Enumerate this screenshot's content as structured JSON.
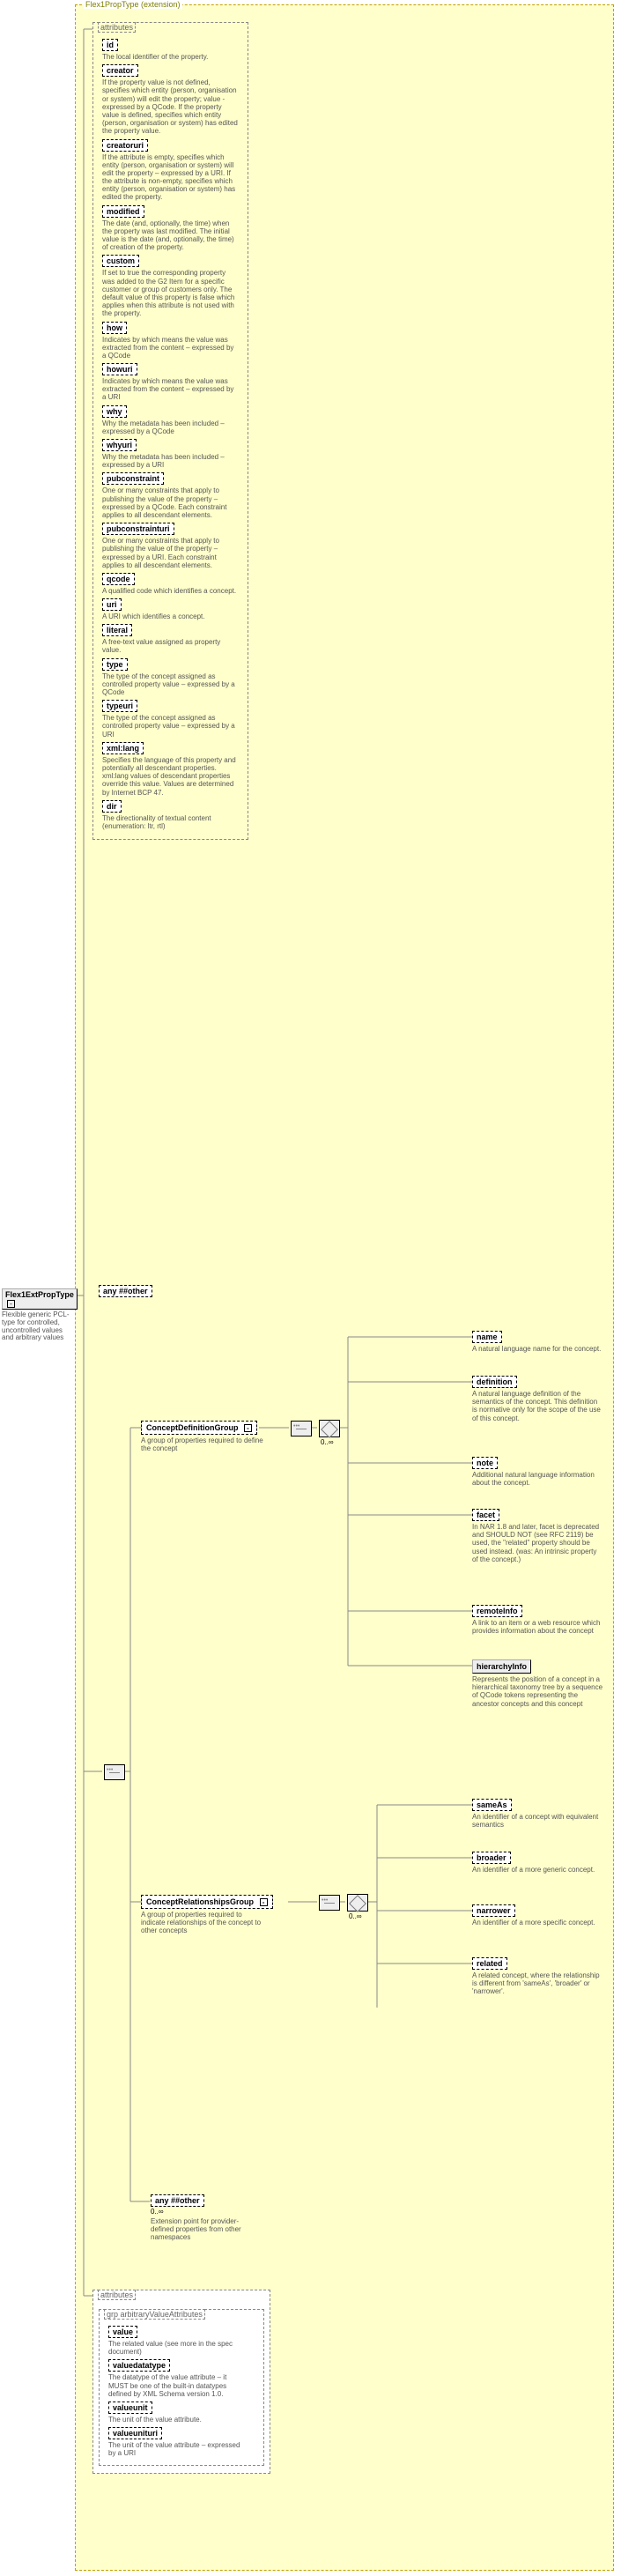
{
  "extension_label": "Flex1PropType (extension)",
  "root": {
    "name": "Flex1ExtPropType",
    "desc": "Flexible generic PCL-type for controlled, uncontrolled values and arbitrary values"
  },
  "top_attrs_label": "attributes",
  "top_attrs": [
    {
      "name": "id",
      "desc": "The local identifier of the property."
    },
    {
      "name": "creator",
      "desc": "If the property value is not defined, specifies which entity (person, organisation or system) will edit the property; value - expressed by a QCode. If the property value is defined, specifies which entity (person, organisation or system) has edited the property value."
    },
    {
      "name": "creatoruri",
      "desc": "If the attribute is empty, specifies which entity (person, organisation or system) will edit the property – expressed by a URI. If the attribute is non-empty, specifies which entity (person, organisation or system) has edited the property."
    },
    {
      "name": "modified",
      "desc": "The date (and, optionally, the time) when the property was last modified. The initial value is the date (and, optionally, the time) of creation of the property."
    },
    {
      "name": "custom",
      "desc": "If set to true the corresponding property was added to the G2 Item for a specific customer or group of customers only. The default value of this property is false which applies when this attribute is not used with the property."
    },
    {
      "name": "how",
      "desc": "Indicates by which means the value was extracted from the content – expressed by a QCode"
    },
    {
      "name": "howuri",
      "desc": "Indicates by which means the value was extracted from the content – expressed by a URI"
    },
    {
      "name": "why",
      "desc": "Why the metadata has been included – expressed by a QCode"
    },
    {
      "name": "whyuri",
      "desc": "Why the metadata has been included – expressed by a URI"
    },
    {
      "name": "pubconstraint",
      "desc": "One or many constraints that apply to publishing the value of the property – expressed by a QCode. Each constraint applies to all descendant elements."
    },
    {
      "name": "pubconstrainturi",
      "desc": "One or many constraints that apply to publishing the value of the property – expressed by a URI. Each constraint applies to all descendant elements."
    },
    {
      "name": "qcode",
      "desc": "A qualified code which identifies a concept."
    },
    {
      "name": "uri",
      "desc": "A URI which identifies a concept."
    },
    {
      "name": "literal",
      "desc": "A free-text value assigned as property value."
    },
    {
      "name": "type",
      "desc": "The type of the concept assigned as controlled property value – expressed by a QCode"
    },
    {
      "name": "typeuri",
      "desc": "The type of the concept assigned as controlled property value – expressed by a URI"
    },
    {
      "name": "xml:lang",
      "desc": "Specifies the language of this property and potentially all descendant properties. xml:lang values of descendant properties override this value. Values are determined by Internet BCP 47."
    },
    {
      "name": "dir",
      "desc": "The directionality of textual content (enumeration: ltr, rtl)"
    }
  ],
  "any_attr_label": "any ##other",
  "cdg": {
    "name": "ConceptDefinitionGroup",
    "desc": "A group of properties required to define the concept"
  },
  "crg": {
    "name": "ConceptRelationshipsGroup",
    "desc": "A group of properties required to indicate relationships of the concept to other concepts"
  },
  "any_elem": {
    "label": "any ##other",
    "card": "0..∞",
    "desc": "Extension point for provider-defined properties from other namespaces"
  },
  "card_0inf": "0..∞",
  "cdg_children": [
    {
      "name": "name",
      "desc": "A natural language name for the concept."
    },
    {
      "name": "definition",
      "desc": "A natural language definition of the semantics of the concept. This definition is normative only for the scope of the use of this concept."
    },
    {
      "name": "note",
      "desc": "Additional natural language information about the concept."
    },
    {
      "name": "facet",
      "desc": "In NAR 1.8 and later, facet is deprecated and SHOULD NOT (see RFC 2119) be used, the \"related\" property should be used instead. (was: An intrinsic property of the concept.)"
    },
    {
      "name": "remoteInfo",
      "desc": "A link to an item or a web resource which provides information about the concept"
    },
    {
      "name": "hierarchyInfo",
      "desc": "Represents the position of a concept in a hierarchical taxonomy tree by a sequence of QCode tokens representing the ancestor concepts and this concept"
    }
  ],
  "crg_children": [
    {
      "name": "sameAs",
      "desc": "An identifier of a concept with equivalent semantics"
    },
    {
      "name": "broader",
      "desc": "An identifier of a more generic concept."
    },
    {
      "name": "narrower",
      "desc": "An identifier of a more specific concept."
    },
    {
      "name": "related",
      "desc": "A related concept, where the relationship is different from 'sameAs', 'broader' or 'narrower'."
    }
  ],
  "bottom_attrs_label": "attributes",
  "arbi_label": "grp arbitraryValueAttributes",
  "arbi": [
    {
      "name": "value",
      "desc": "The related value (see more in the spec document)"
    },
    {
      "name": "valuedatatype",
      "desc": "The datatype of the value attribute – it MUST be one of the built-in datatypes defined by XML Schema version 1.0."
    },
    {
      "name": "valueunit",
      "desc": "The unit of the value attribute."
    },
    {
      "name": "valueunituri",
      "desc": "The unit of the value attribute – expressed by a URI"
    }
  ]
}
